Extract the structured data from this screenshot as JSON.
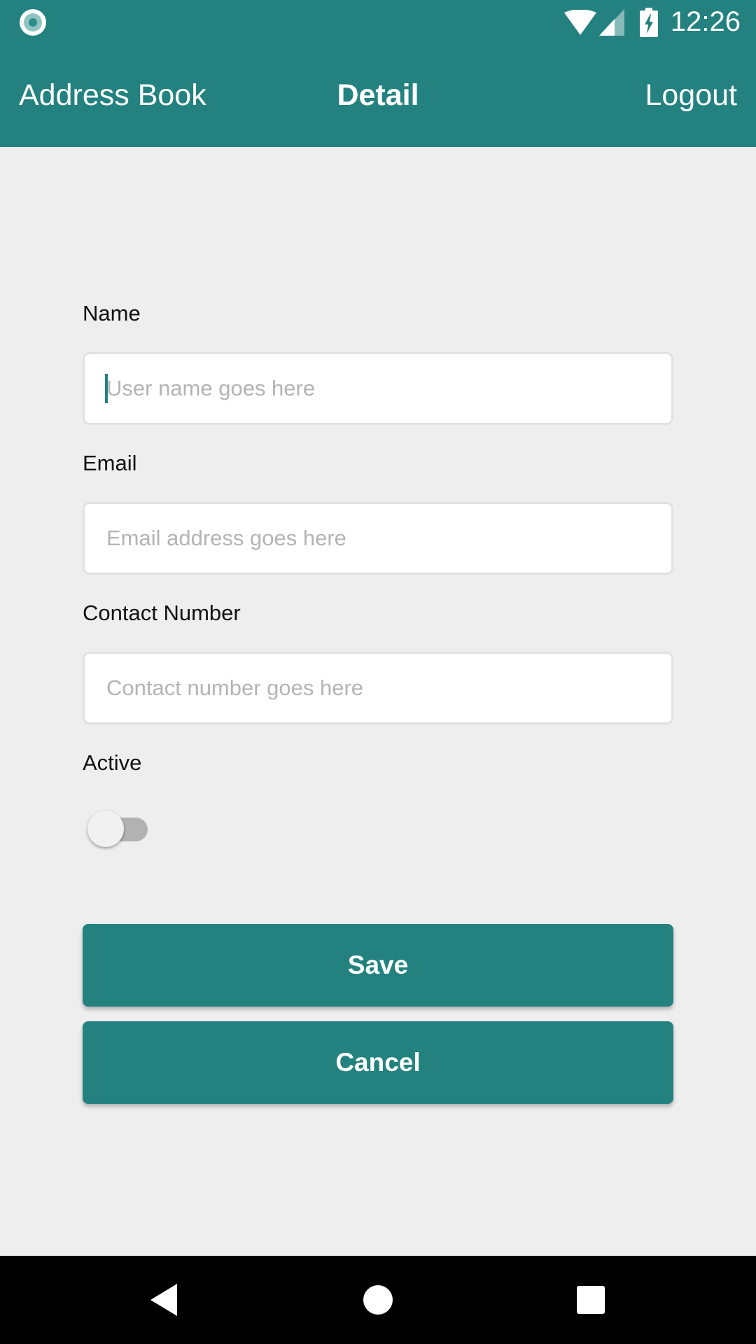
{
  "status_bar": {
    "time": "12:26",
    "icons": [
      "notification-icon",
      "wifi-icon",
      "cellular-signal-icon",
      "battery-charging-icon"
    ]
  },
  "app_bar": {
    "app_title": "Address Book",
    "screen_title": "Detail",
    "logout_label": "Logout",
    "color": "#238280"
  },
  "form": {
    "name": {
      "label": "Name",
      "placeholder": "User name goes here",
      "value": ""
    },
    "email": {
      "label": "Email",
      "placeholder": "Email address goes here",
      "value": ""
    },
    "contact_number": {
      "label": "Contact Number",
      "placeholder": "Contact number goes here",
      "value": ""
    },
    "active": {
      "label": "Active",
      "checked": false
    }
  },
  "actions": {
    "save_label": "Save",
    "cancel_label": "Cancel"
  },
  "nav_bar": {
    "icons": [
      "back-icon",
      "home-icon",
      "recents-icon"
    ]
  }
}
